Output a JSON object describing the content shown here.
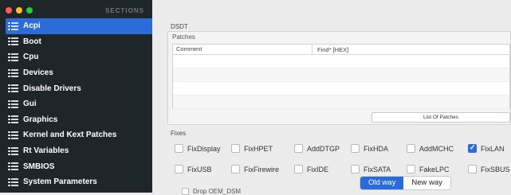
{
  "sidebar": {
    "section_header": "SECTIONS",
    "items": [
      {
        "label": "Acpi",
        "active": true
      },
      {
        "label": "Boot"
      },
      {
        "label": "Cpu"
      },
      {
        "label": "Devices"
      },
      {
        "label": "Disable Drivers"
      },
      {
        "label": "Gui"
      },
      {
        "label": "Graphics"
      },
      {
        "label": "Kernel and Kext Patches"
      },
      {
        "label": "Rt Variables"
      },
      {
        "label": "SMBIOS"
      },
      {
        "label": "System Parameters"
      }
    ]
  },
  "main": {
    "dsdt_label": "DSDT",
    "patches": {
      "title": "Patches",
      "columns": [
        "Comment",
        "Find* [HEX]"
      ],
      "list_button": "List Of Patches"
    },
    "fixes": {
      "title": "Fixes",
      "row1": [
        {
          "label": "FixDisplay",
          "checked": false
        },
        {
          "label": "FixHPET",
          "checked": false
        },
        {
          "label": "AddDTGP",
          "checked": false
        },
        {
          "label": "FixHDA",
          "checked": false
        },
        {
          "label": "AddMCHC",
          "checked": false
        },
        {
          "label": "FixLAN",
          "checked": true
        }
      ],
      "row2": [
        {
          "label": "FixUSB",
          "checked": false
        },
        {
          "label": "FixFirewire",
          "checked": false
        },
        {
          "label": "FixIDE",
          "checked": false
        },
        {
          "label": "FixSATA",
          "checked": false
        },
        {
          "label": "FakeLPC",
          "checked": false
        },
        {
          "label": "FixSBUS",
          "checked": false
        }
      ]
    },
    "segmented": {
      "old": "Old way",
      "new": "New way",
      "selected": "Old way"
    },
    "drop_label": "Drop OEM_DSM"
  },
  "colors": {
    "accent": "#2b6cd8",
    "sidebar_bg": "#1f2629"
  }
}
